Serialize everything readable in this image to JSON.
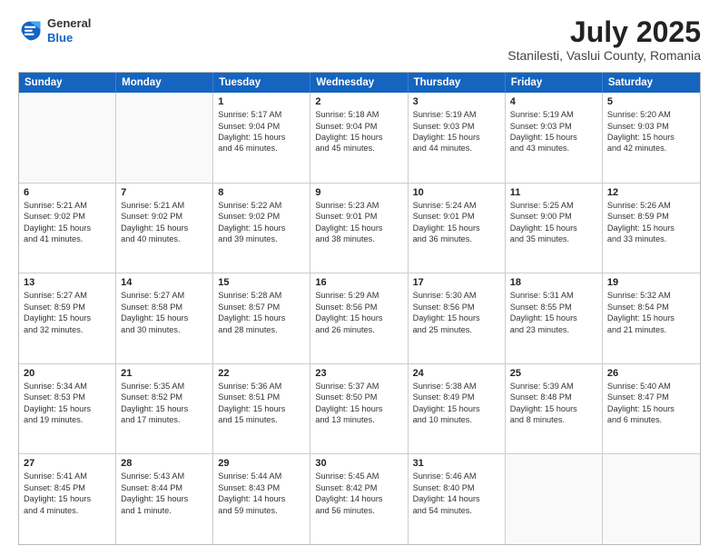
{
  "logo": {
    "general": "General",
    "blue": "Blue"
  },
  "title": "July 2025",
  "location": "Stanilesti, Vaslui County, Romania",
  "header_days": [
    "Sunday",
    "Monday",
    "Tuesday",
    "Wednesday",
    "Thursday",
    "Friday",
    "Saturday"
  ],
  "weeks": [
    [
      {
        "day": "",
        "lines": []
      },
      {
        "day": "",
        "lines": []
      },
      {
        "day": "1",
        "lines": [
          "Sunrise: 5:17 AM",
          "Sunset: 9:04 PM",
          "Daylight: 15 hours",
          "and 46 minutes."
        ]
      },
      {
        "day": "2",
        "lines": [
          "Sunrise: 5:18 AM",
          "Sunset: 9:04 PM",
          "Daylight: 15 hours",
          "and 45 minutes."
        ]
      },
      {
        "day": "3",
        "lines": [
          "Sunrise: 5:19 AM",
          "Sunset: 9:03 PM",
          "Daylight: 15 hours",
          "and 44 minutes."
        ]
      },
      {
        "day": "4",
        "lines": [
          "Sunrise: 5:19 AM",
          "Sunset: 9:03 PM",
          "Daylight: 15 hours",
          "and 43 minutes."
        ]
      },
      {
        "day": "5",
        "lines": [
          "Sunrise: 5:20 AM",
          "Sunset: 9:03 PM",
          "Daylight: 15 hours",
          "and 42 minutes."
        ]
      }
    ],
    [
      {
        "day": "6",
        "lines": [
          "Sunrise: 5:21 AM",
          "Sunset: 9:02 PM",
          "Daylight: 15 hours",
          "and 41 minutes."
        ]
      },
      {
        "day": "7",
        "lines": [
          "Sunrise: 5:21 AM",
          "Sunset: 9:02 PM",
          "Daylight: 15 hours",
          "and 40 minutes."
        ]
      },
      {
        "day": "8",
        "lines": [
          "Sunrise: 5:22 AM",
          "Sunset: 9:02 PM",
          "Daylight: 15 hours",
          "and 39 minutes."
        ]
      },
      {
        "day": "9",
        "lines": [
          "Sunrise: 5:23 AM",
          "Sunset: 9:01 PM",
          "Daylight: 15 hours",
          "and 38 minutes."
        ]
      },
      {
        "day": "10",
        "lines": [
          "Sunrise: 5:24 AM",
          "Sunset: 9:01 PM",
          "Daylight: 15 hours",
          "and 36 minutes."
        ]
      },
      {
        "day": "11",
        "lines": [
          "Sunrise: 5:25 AM",
          "Sunset: 9:00 PM",
          "Daylight: 15 hours",
          "and 35 minutes."
        ]
      },
      {
        "day": "12",
        "lines": [
          "Sunrise: 5:26 AM",
          "Sunset: 8:59 PM",
          "Daylight: 15 hours",
          "and 33 minutes."
        ]
      }
    ],
    [
      {
        "day": "13",
        "lines": [
          "Sunrise: 5:27 AM",
          "Sunset: 8:59 PM",
          "Daylight: 15 hours",
          "and 32 minutes."
        ]
      },
      {
        "day": "14",
        "lines": [
          "Sunrise: 5:27 AM",
          "Sunset: 8:58 PM",
          "Daylight: 15 hours",
          "and 30 minutes."
        ]
      },
      {
        "day": "15",
        "lines": [
          "Sunrise: 5:28 AM",
          "Sunset: 8:57 PM",
          "Daylight: 15 hours",
          "and 28 minutes."
        ]
      },
      {
        "day": "16",
        "lines": [
          "Sunrise: 5:29 AM",
          "Sunset: 8:56 PM",
          "Daylight: 15 hours",
          "and 26 minutes."
        ]
      },
      {
        "day": "17",
        "lines": [
          "Sunrise: 5:30 AM",
          "Sunset: 8:56 PM",
          "Daylight: 15 hours",
          "and 25 minutes."
        ]
      },
      {
        "day": "18",
        "lines": [
          "Sunrise: 5:31 AM",
          "Sunset: 8:55 PM",
          "Daylight: 15 hours",
          "and 23 minutes."
        ]
      },
      {
        "day": "19",
        "lines": [
          "Sunrise: 5:32 AM",
          "Sunset: 8:54 PM",
          "Daylight: 15 hours",
          "and 21 minutes."
        ]
      }
    ],
    [
      {
        "day": "20",
        "lines": [
          "Sunrise: 5:34 AM",
          "Sunset: 8:53 PM",
          "Daylight: 15 hours",
          "and 19 minutes."
        ]
      },
      {
        "day": "21",
        "lines": [
          "Sunrise: 5:35 AM",
          "Sunset: 8:52 PM",
          "Daylight: 15 hours",
          "and 17 minutes."
        ]
      },
      {
        "day": "22",
        "lines": [
          "Sunrise: 5:36 AM",
          "Sunset: 8:51 PM",
          "Daylight: 15 hours",
          "and 15 minutes."
        ]
      },
      {
        "day": "23",
        "lines": [
          "Sunrise: 5:37 AM",
          "Sunset: 8:50 PM",
          "Daylight: 15 hours",
          "and 13 minutes."
        ]
      },
      {
        "day": "24",
        "lines": [
          "Sunrise: 5:38 AM",
          "Sunset: 8:49 PM",
          "Daylight: 15 hours",
          "and 10 minutes."
        ]
      },
      {
        "day": "25",
        "lines": [
          "Sunrise: 5:39 AM",
          "Sunset: 8:48 PM",
          "Daylight: 15 hours",
          "and 8 minutes."
        ]
      },
      {
        "day": "26",
        "lines": [
          "Sunrise: 5:40 AM",
          "Sunset: 8:47 PM",
          "Daylight: 15 hours",
          "and 6 minutes."
        ]
      }
    ],
    [
      {
        "day": "27",
        "lines": [
          "Sunrise: 5:41 AM",
          "Sunset: 8:45 PM",
          "Daylight: 15 hours",
          "and 4 minutes."
        ]
      },
      {
        "day": "28",
        "lines": [
          "Sunrise: 5:43 AM",
          "Sunset: 8:44 PM",
          "Daylight: 15 hours",
          "and 1 minute."
        ]
      },
      {
        "day": "29",
        "lines": [
          "Sunrise: 5:44 AM",
          "Sunset: 8:43 PM",
          "Daylight: 14 hours",
          "and 59 minutes."
        ]
      },
      {
        "day": "30",
        "lines": [
          "Sunrise: 5:45 AM",
          "Sunset: 8:42 PM",
          "Daylight: 14 hours",
          "and 56 minutes."
        ]
      },
      {
        "day": "31",
        "lines": [
          "Sunrise: 5:46 AM",
          "Sunset: 8:40 PM",
          "Daylight: 14 hours",
          "and 54 minutes."
        ]
      },
      {
        "day": "",
        "lines": []
      },
      {
        "day": "",
        "lines": []
      }
    ]
  ]
}
